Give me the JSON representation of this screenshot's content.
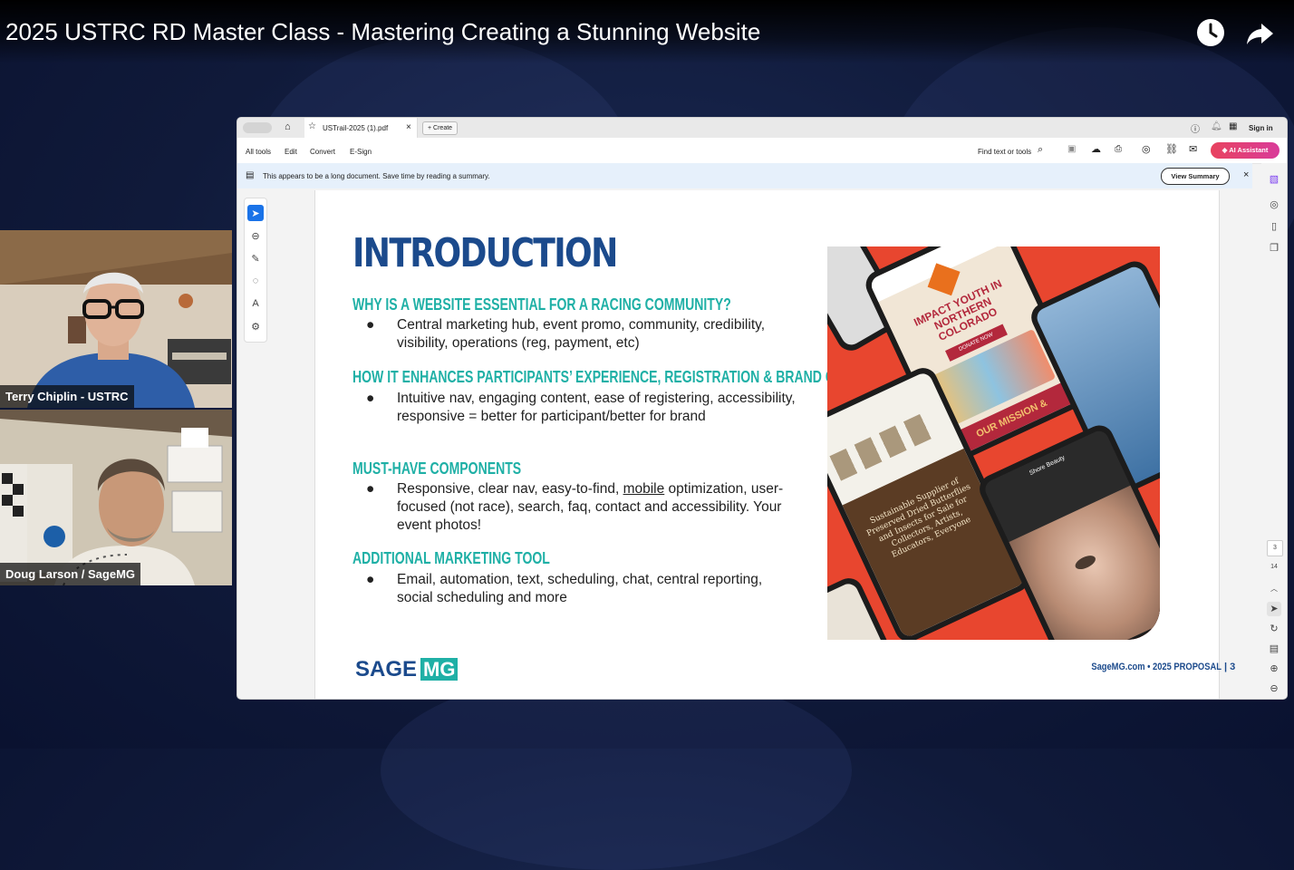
{
  "video": {
    "title": "2025 USTRC RD Master Class - Mastering Creating a Stunning Website",
    "icons": [
      "watch-later-icon",
      "share-icon"
    ]
  },
  "participants": [
    {
      "name": "Terry Chiplin - USTRC"
    },
    {
      "name": "Doug Larson / SageMG"
    }
  ],
  "acrobat": {
    "tab_label": "USTrail-2025 (1).pdf",
    "create_label": "Create",
    "sign_in_label": "Sign in",
    "menu": [
      "All tools",
      "Edit",
      "Convert",
      "E-Sign"
    ],
    "find_label": "Find text or tools",
    "ai_assistant_label": "AI Assistant",
    "summary_message": "This appears to be a long document. Save time by reading a summary.",
    "view_summary_label": "View Summary",
    "page_current": "3",
    "page_total": "14"
  },
  "slide": {
    "title": "INTRODUCTION",
    "sections": [
      {
        "heading": "WHY IS A WEBSITE ESSENTIAL FOR A RACING COMMUNITY?",
        "bullet": "Central marketing hub, event promo, community, credibility, visibility, operations (reg, payment, etc)"
      },
      {
        "heading": "HOW IT ENHANCES PARTICIPANTS’ EXPERIENCE, REGISTRATION & BRAND CRED",
        "bullet": "Intuitive nav, engaging content, ease of registering, accessibility, responsive = better for participant/better for brand"
      },
      {
        "heading": "MUST-HAVE COMPONENTS",
        "bullet_pre": "Responsive, clear nav, easy-to-find, ",
        "bullet_link": "mobile",
        "bullet_post": " optimization, user-focused (not race), search, faq, contact and accessibility. Your event photos!"
      },
      {
        "heading": "ADDITIONAL MARKETING TOOL",
        "bullet": "Email, automation, text, scheduling, chat, central reporting, social scheduling and more"
      }
    ],
    "bullet_char": "●",
    "phone_texts": {
      "headline": "IMPACT YOUTH IN NORTHERN COLORADO",
      "button": "DONATE NOW",
      "mission": "OUR MISSION &",
      "supplier": "Sustainable Supplier of Preserved Dried Butterflies and Insects for Sale for Collectors, Artists, Educators, Everyone",
      "brand": "Shore Beauty"
    },
    "logo_sage": "SAGE",
    "logo_mg": "MG",
    "footer": "SageMG.com • 2025 PROPOSAL",
    "page_number": "3"
  },
  "colors": {
    "navy": "#1b4a8c",
    "teal": "#1fb0a6",
    "accent_red": "#e8462f",
    "ai_pink": "#e8435f"
  }
}
